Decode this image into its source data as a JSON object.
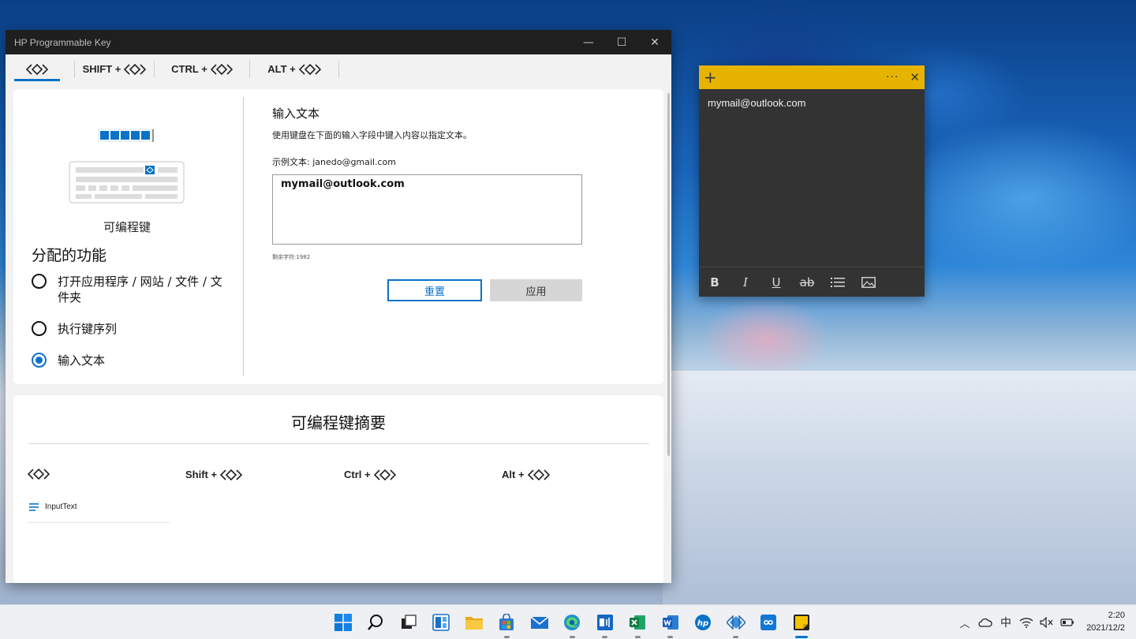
{
  "window": {
    "title": "HP Programmable Key",
    "minimize": "—",
    "maximize": "☐",
    "close": "✕"
  },
  "tabs": [
    {
      "label": "",
      "active": true
    },
    {
      "label": "SHIFT +"
    },
    {
      "label": "CTRL +"
    },
    {
      "label": "ALT +"
    }
  ],
  "left_panel": {
    "key_caption": "可编程键",
    "assign_title": "分配的功能",
    "options": [
      {
        "label": "打开应用程序 / 网站 / 文件 / 文件夹",
        "checked": false
      },
      {
        "label": "执行键序列",
        "checked": false
      },
      {
        "label": "输入文本",
        "checked": true
      }
    ]
  },
  "right_panel": {
    "title": "输入文本",
    "description": "使用键盘在下面的输入字段中键入内容以指定文本。",
    "example": "示例文本: janedo@gmail.com",
    "input_value": "mymail@outlook.com",
    "remaining": "剩余字符:1982",
    "reset_label": "重置",
    "apply_label": "应用"
  },
  "summary": {
    "title": "可编程键摘要",
    "columns": [
      {
        "label": ""
      },
      {
        "label": "Shift +"
      },
      {
        "label": "Ctrl +"
      },
      {
        "label": "Alt +"
      }
    ],
    "item_label": "InputText"
  },
  "sticky": {
    "add": "+",
    "menu": "···",
    "close": "✕",
    "content": "mymail@outlook.com",
    "tools": [
      "B",
      "I",
      "U",
      "ab"
    ]
  },
  "tray": {
    "chevron": "︿",
    "ime": "中",
    "time": "2:20",
    "date": "2021/12/2"
  },
  "colors": {
    "accent": "#0a72c9",
    "sticky_header": "#e6b400",
    "sticky_body": "#333333",
    "titlebar": "#1f1f1f"
  }
}
